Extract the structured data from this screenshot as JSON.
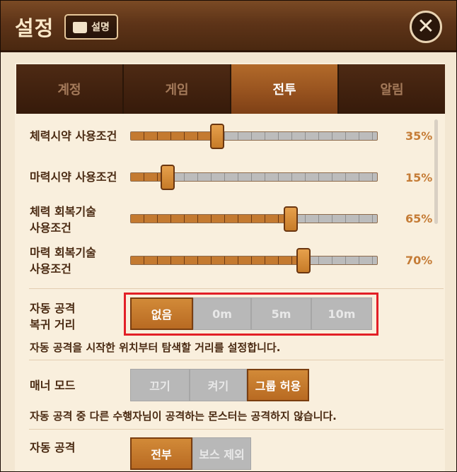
{
  "header": {
    "title": "설정",
    "help_label": "설명",
    "close_symbol": "✕"
  },
  "tabs": [
    {
      "label": "계정",
      "active": false
    },
    {
      "label": "게임",
      "active": false
    },
    {
      "label": "전투",
      "active": true
    },
    {
      "label": "알림",
      "active": false
    }
  ],
  "sliders": [
    {
      "label": "체력시약 사용조건",
      "value": 35,
      "value_text": "35%"
    },
    {
      "label": "마력시약 사용조건",
      "value": 15,
      "value_text": "15%"
    },
    {
      "label_line1": "체력 회복기술",
      "label_line2": "사용조건",
      "value": 65,
      "value_text": "65%"
    },
    {
      "label_line1": "마력 회복기술",
      "label_line2": "사용조건",
      "value": 70,
      "value_text": "70%"
    }
  ],
  "auto_return": {
    "label_line1": "자동 공격",
    "label_line2": "복귀 거리",
    "options": [
      "없음",
      "0m",
      "5m",
      "10m"
    ],
    "selected": "없음",
    "description": "자동 공격을 시작한 위치부터 탐색할 거리를 설정합니다."
  },
  "manner_mode": {
    "label": "매너 모드",
    "options": [
      "끄기",
      "켜기",
      "그룹 허용"
    ],
    "selected": "그룹 허용",
    "description": "자동 공격 중 다른 수행자님이 공격하는 몬스터는 공격하지 않습니다."
  },
  "auto_target": {
    "label": "자동 공격",
    "options": [
      "전부",
      "보스 제외"
    ],
    "selected": "전부"
  },
  "colors": {
    "accent": "#c57c36",
    "highlight_border": "#e21f26",
    "header_bg": "#5e3418"
  }
}
